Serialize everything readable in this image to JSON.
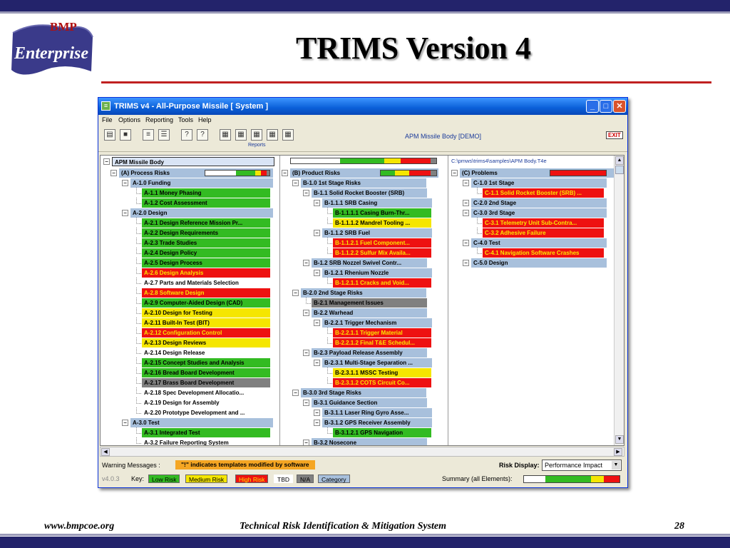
{
  "slide": {
    "logo_top": "BMP",
    "logo_bottom": "Enterprise",
    "title": "TRIMS Version 4",
    "footer_left": "www.bmpcoe.org",
    "footer_center": "Technical Risk Identification & Mitigation System",
    "footer_page": "28"
  },
  "window": {
    "title": "TRIMS v4 - All-Purpose Missile [ System ]",
    "menu": [
      "File",
      "Options",
      "Reporting",
      "Tools",
      "Help"
    ],
    "toolbar_reports_label": "Reports",
    "toolbar_center": "APM Missile Body  [DEMO]",
    "exit_label": "EXIT",
    "root_label": "APM Missile Body",
    "path": "C:\\pmws\\trims4\\samples\\APM Body.T4e"
  },
  "colors": {
    "green": "#33bb22",
    "yellow": "#f5e600",
    "red": "#ee1111",
    "gray": "#808080",
    "tbd": "#ffffff",
    "category": "#a8c0dc"
  },
  "process": [
    {
      "label": "(A) Process Risks",
      "cls": "blue",
      "lvl": 0
    },
    {
      "label": "A-1.0 Funding",
      "cls": "blue",
      "lvl": 1
    },
    {
      "label": "A-1.1 Money Phasing",
      "cls": "green",
      "lvl": 2
    },
    {
      "label": "A-1.2 Cost Assessment",
      "cls": "green",
      "lvl": 2
    },
    {
      "label": "A-2.0 Design",
      "cls": "blue",
      "lvl": 1
    },
    {
      "label": "A-2.1 Design Reference Mission Pr...",
      "cls": "green",
      "lvl": 2
    },
    {
      "label": "A-2.2 Design Requirements",
      "cls": "green",
      "lvl": 2
    },
    {
      "label": "A-2.3 Trade Studies",
      "cls": "green",
      "lvl": 2
    },
    {
      "label": "A-2.4 Design Policy",
      "cls": "green",
      "lvl": 2
    },
    {
      "label": "A-2.5 Design Process",
      "cls": "green",
      "lvl": 2
    },
    {
      "label": "A-2.6 Design Analysis",
      "cls": "red",
      "lvl": 2
    },
    {
      "label": "A-2.7 Parts and Materials Selection",
      "cls": "white",
      "lvl": 2
    },
    {
      "label": "A-2.8 Software Design",
      "cls": "red",
      "lvl": 2
    },
    {
      "label": "A-2.9 Computer-Aided Design (CAD)",
      "cls": "green",
      "lvl": 2
    },
    {
      "label": "A-2.10 Design for Testing",
      "cls": "yellow",
      "lvl": 2
    },
    {
      "label": "A-2.11 Built-In Test (BIT)",
      "cls": "yellow",
      "lvl": 2
    },
    {
      "label": "A-2.12 Configuration Control",
      "cls": "red",
      "lvl": 2
    },
    {
      "label": "A-2.13 Design Reviews",
      "cls": "yellow",
      "lvl": 2
    },
    {
      "label": "A-2.14 Design Release",
      "cls": "white",
      "lvl": 2
    },
    {
      "label": "A-2.15 Concept Studies and Analysis",
      "cls": "green",
      "lvl": 2
    },
    {
      "label": "A-2.16 Bread Board Development",
      "cls": "green",
      "lvl": 2
    },
    {
      "label": "A-2.17 Brass Board Development",
      "cls": "gray",
      "lvl": 2
    },
    {
      "label": "A-2.18 Spec Development Allocatio...",
      "cls": "white",
      "lvl": 2
    },
    {
      "label": "A-2.19 Design for Assembly",
      "cls": "white",
      "lvl": 2
    },
    {
      "label": "A-2.20 Prototype Development and ...",
      "cls": "white",
      "lvl": 2
    },
    {
      "label": "A-3.0 Test",
      "cls": "blue",
      "lvl": 1
    },
    {
      "label": "A-3.1 Integrated Test",
      "cls": "green",
      "lvl": 2
    },
    {
      "label": "A-3.2 Failure Reporting System",
      "cls": "white",
      "lvl": 2
    }
  ],
  "product": [
    {
      "label": "(B) Product Risks",
      "cls": "blue",
      "lvl": 0
    },
    {
      "label": "B-1.0 1st Stage Risks",
      "cls": "blue",
      "lvl": 1
    },
    {
      "label": "B-1.1 Solid Rocket Booster (SRB)",
      "cls": "blue",
      "lvl": 2
    },
    {
      "label": "B-1.1.1 SRB Casing",
      "cls": "blue",
      "lvl": 3
    },
    {
      "label": "B-1.1.1.1 Casing Burn-Thr...",
      "cls": "green",
      "lvl": 4
    },
    {
      "label": "B-1.1.1.2 Mandrel Tooling ...",
      "cls": "yellow",
      "lvl": 4
    },
    {
      "label": "B-1.1.2 SRB Fuel",
      "cls": "blue",
      "lvl": 3
    },
    {
      "label": "B-1.1.2.1 Fuel Component...",
      "cls": "red",
      "lvl": 4
    },
    {
      "label": "B-1.1.2.2 Sulfur Mix Availa...",
      "cls": "red",
      "lvl": 4
    },
    {
      "label": "B-1.2 SRB Nozzel Swivel Contr...",
      "cls": "blue",
      "lvl": 2
    },
    {
      "label": "B-1.2.1 Rhenium Nozzle",
      "cls": "blue",
      "lvl": 3
    },
    {
      "label": "B-1.2.1.1 Cracks and Void...",
      "cls": "red",
      "lvl": 4
    },
    {
      "label": "B-2.0 2nd Stage Risks",
      "cls": "blue",
      "lvl": 1
    },
    {
      "label": "B-2.1 Management Issues",
      "cls": "gray",
      "lvl": 2
    },
    {
      "label": "B-2.2 Warhead",
      "cls": "blue",
      "lvl": 2
    },
    {
      "label": "B-2.2.1 Trigger Mechanism",
      "cls": "blue",
      "lvl": 3
    },
    {
      "label": "B-2.2.1.1 Trigger Material",
      "cls": "red",
      "lvl": 4
    },
    {
      "label": "B-2.2.1.2 Final T&E Schedul...",
      "cls": "red",
      "lvl": 4
    },
    {
      "label": "B-2.3 Payload Release Assembly",
      "cls": "blue",
      "lvl": 2
    },
    {
      "label": "B-2.3.1 Multi-Stage Separation ...",
      "cls": "blue",
      "lvl": 3
    },
    {
      "label": "B-2.3.1.1 MSSC Testing",
      "cls": "yellow",
      "lvl": 4
    },
    {
      "label": "B-2.3.1.2 COTS Circuit Co...",
      "cls": "red",
      "lvl": 4
    },
    {
      "label": "B-3.0 3rd Stage Risks",
      "cls": "blue",
      "lvl": 1
    },
    {
      "label": "B-3.1 Guidance Section",
      "cls": "blue",
      "lvl": 2
    },
    {
      "label": "B-3.1.1 Laser Ring Gyro Asse...",
      "cls": "blue",
      "lvl": 3
    },
    {
      "label": "B-3.1.2 GPS Receiver Assembly",
      "cls": "blue",
      "lvl": 3
    },
    {
      "label": "B-3.1.2.1 GPS Navigation",
      "cls": "green",
      "lvl": 4
    },
    {
      "label": "B-3.2 Nosecone",
      "cls": "blue",
      "lvl": 2
    }
  ],
  "problems": [
    {
      "label": "(C) Problems",
      "cls": "blue",
      "lvl": 0
    },
    {
      "label": "C-1.0 1st Stage",
      "cls": "blue",
      "lvl": 1
    },
    {
      "label": "C-1.1 Solid Rocket Booster (SRB) ...",
      "cls": "red",
      "lvl": 2
    },
    {
      "label": "C-2.0 2nd Stage",
      "cls": "blue",
      "lvl": 1
    },
    {
      "label": "C-3.0 3rd Stage",
      "cls": "blue",
      "lvl": 1
    },
    {
      "label": "C-3.1 Telemetry Unit Sub-Contra...",
      "cls": "red",
      "lvl": 2
    },
    {
      "label": "C-3.2 Adhesive Failure",
      "cls": "red",
      "lvl": 2
    },
    {
      "label": "C-4.0 Test",
      "cls": "blue",
      "lvl": 1
    },
    {
      "label": "C-4.1 Navigation Software Crashes",
      "cls": "red",
      "lvl": 2
    },
    {
      "label": "C-5.0 Design",
      "cls": "blue",
      "lvl": 1
    }
  ],
  "status": {
    "warning_label": "Warning Messages :",
    "warning_text": "\"!\" indicates templates modified by software",
    "risk_display_label": "Risk Display:",
    "risk_display_value": "Performance Impact",
    "version": "v4.0.3",
    "key_label": "Key:",
    "key_low": "Low Risk",
    "key_medium": "Medium Risk",
    "key_high": "High Risk",
    "key_tbd": "TBD",
    "key_na": "N/A",
    "key_category": "Category",
    "summary_label": "Summary (all Elements):"
  }
}
